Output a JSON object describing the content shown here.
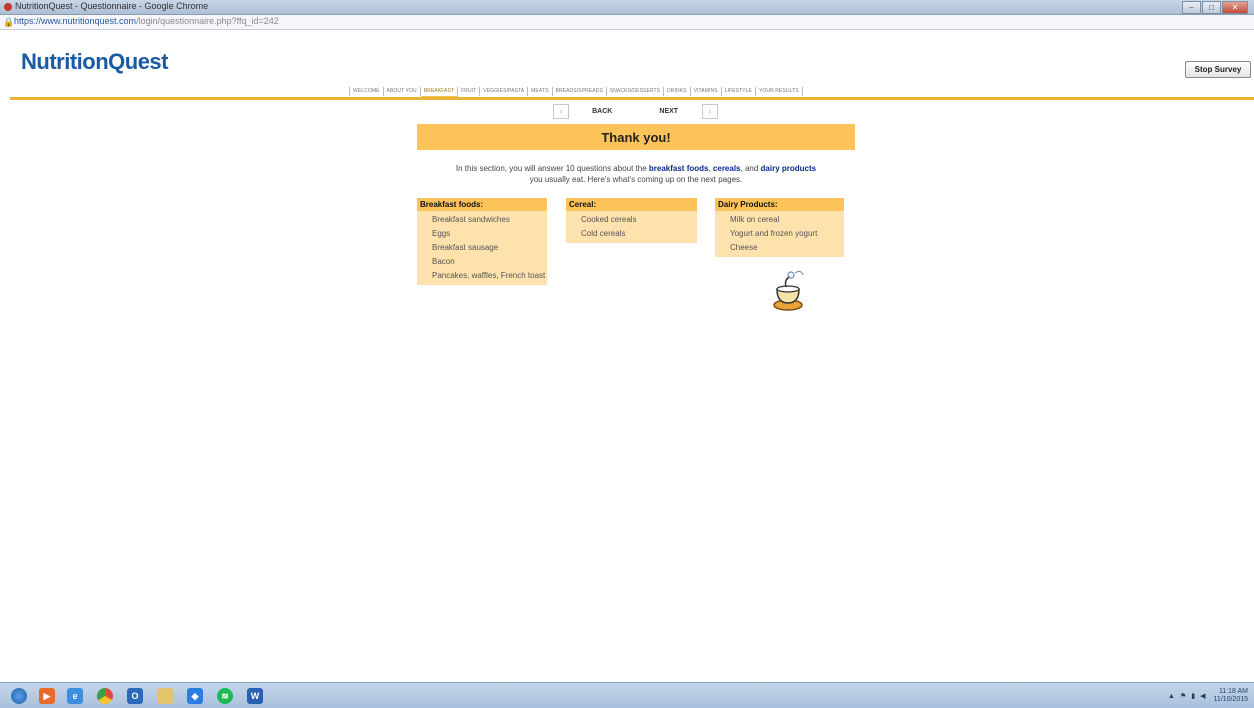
{
  "browser": {
    "window_title": "NutritionQuest - Questionnaire - Google Chrome",
    "url_host": "https://www.nutritionquest.com",
    "url_path": "/login/questionnaire.php?ffq_id=242"
  },
  "header": {
    "logo": "NutritionQuest",
    "stop_label": "Stop Survey"
  },
  "nav": {
    "tabs": [
      "WELCOME",
      "ABOUT YOU",
      "BREAKFAST",
      "FRUIT",
      "VEGGIES/PASTA",
      "MEATS",
      "BREADS/SPREADS",
      "SNACKS/DESSERTS",
      "DRINKS",
      "VITAMINS",
      "LIFESTYLE",
      "YOUR RESULTS"
    ],
    "active": "BREAKFAST",
    "back_label": "BACK",
    "next_label": "NEXT"
  },
  "main": {
    "heading": "Thank you!",
    "intro_part1": "In this section, you will answer 10 questions about the ",
    "intro_bold1": "breakfast foods",
    "intro_sep1": ", ",
    "intro_bold2": "cereals",
    "intro_sep2": ", and ",
    "intro_bold3": "dairy products",
    "intro_part2": "you usually eat. Here's what's coming up on the next pages."
  },
  "categories": {
    "breakfast": {
      "title": "Breakfast foods:",
      "items": [
        "Breakfast sandwiches",
        "Eggs",
        "Breakfast sausage",
        "Bacon",
        "Pancakes, waffles, French toast"
      ]
    },
    "cereal": {
      "title": "Cereal:",
      "items": [
        "Cooked cereals",
        "Cold cereals"
      ]
    },
    "dairy": {
      "title": "Dairy Products:",
      "items": [
        "Milk on cereal",
        "Yogurt and frozen yogurt",
        "Cheese"
      ]
    }
  },
  "taskbar": {
    "clock_time": "11:18 AM",
    "clock_date": "11/10/2015"
  }
}
